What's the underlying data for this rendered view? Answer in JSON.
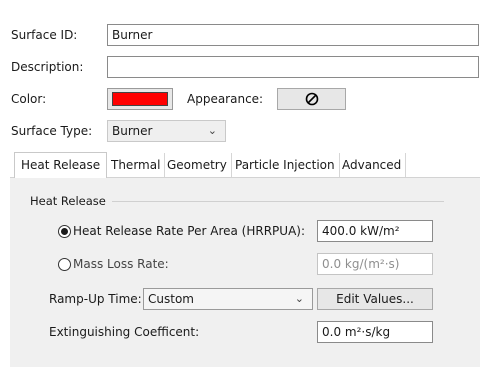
{
  "surface": {
    "id_label": "Surface ID:",
    "id_value": "Burner",
    "description_label": "Description:",
    "description_value": "",
    "color_label": "Color:",
    "color_value": "#ff0000",
    "appearance_label": "Appearance:",
    "appearance_icon": "no-texture-icon",
    "type_label": "Surface Type:",
    "type_value": "Burner"
  },
  "tabs": [
    {
      "label": "Heat Release",
      "active": true
    },
    {
      "label": "Thermal",
      "active": false
    },
    {
      "label": "Geometry",
      "active": false
    },
    {
      "label": "Particle Injection",
      "active": false
    },
    {
      "label": "Advanced",
      "active": false
    }
  ],
  "heat_release": {
    "group_title": "Heat Release",
    "hrrpua_label": "Heat Release Rate Per Area (HRRPUA):",
    "hrrpua_value": "400.0 kW/m²",
    "hrrpua_selected": true,
    "mass_loss_label": "Mass Loss Rate:",
    "mass_loss_value": "0.0 kg/(m²·s)",
    "mass_loss_selected": false,
    "ramp_label": "Ramp-Up Time:",
    "ramp_value": "Custom",
    "edit_values_label": "Edit Values...",
    "extinguishing_label": "Extinguishing Coefficent:",
    "extinguishing_value": "0.0 m²·s/kg"
  },
  "colors": {
    "panel_bg": "#f0f0f0",
    "swatch": "#ff0000"
  }
}
